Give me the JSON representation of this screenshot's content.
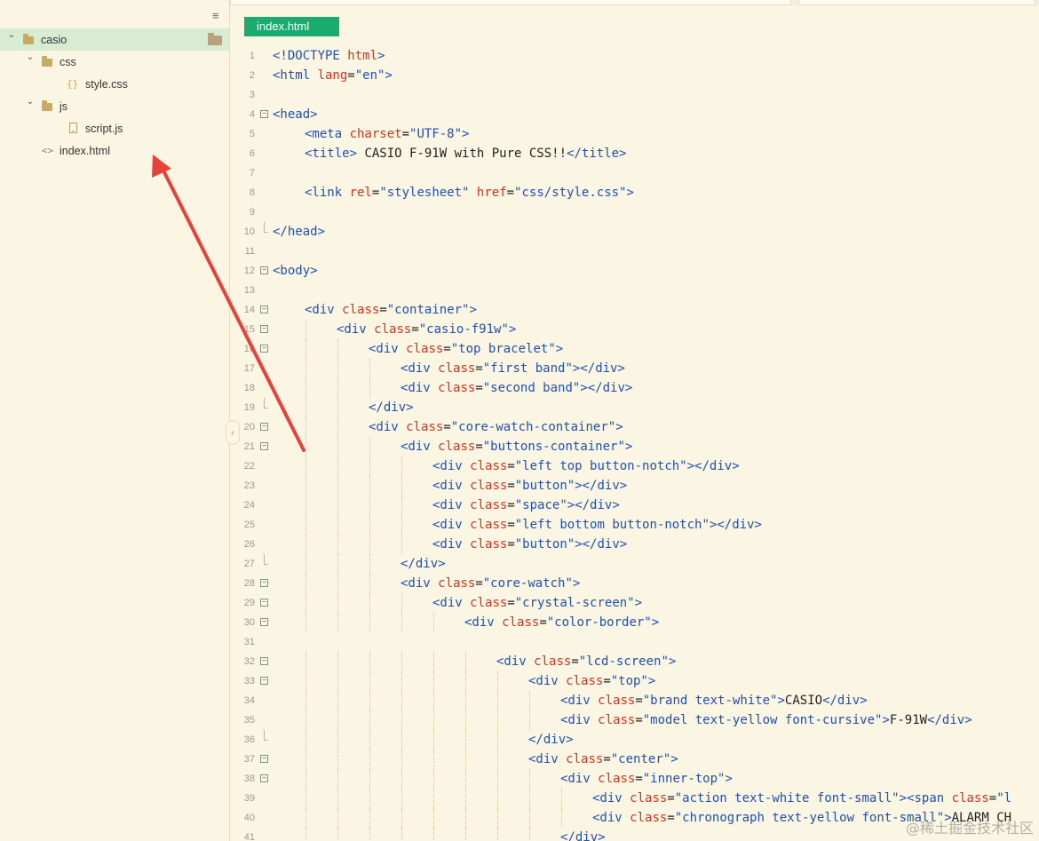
{
  "sidebar": {
    "tree": [
      {
        "label": "casio",
        "type": "folder",
        "depth": 0,
        "expanded": true,
        "selected": true
      },
      {
        "label": "css",
        "type": "folder",
        "depth": 1,
        "expanded": true
      },
      {
        "label": "style.css",
        "type": "css-file",
        "depth": 2
      },
      {
        "label": "js",
        "type": "folder",
        "depth": 1,
        "expanded": true
      },
      {
        "label": "script.js",
        "type": "js-file",
        "depth": 2
      },
      {
        "label": "index.html",
        "type": "html-file",
        "depth": 1
      }
    ],
    "menu_icon": "hamburger-icon",
    "collapse_glyph": "‹"
  },
  "editor": {
    "active_tab": "index.html",
    "lines": [
      {
        "n": "1",
        "indent": 0,
        "tokens": [
          [
            "tag",
            "<!DOCTYPE "
          ],
          [
            "attr",
            "html"
          ],
          [
            "tag",
            ">"
          ]
        ]
      },
      {
        "n": "2",
        "indent": 0,
        "tokens": [
          [
            "tag",
            "<html "
          ],
          [
            "attr",
            "lang"
          ],
          [
            "plain",
            "="
          ],
          [
            "val",
            "\"en\""
          ],
          [
            "tag",
            ">"
          ]
        ]
      },
      {
        "n": "3",
        "indent": 0,
        "tokens": []
      },
      {
        "n": "4",
        "indent": 0,
        "fold": true,
        "tokens": [
          [
            "tag",
            "<head>"
          ]
        ]
      },
      {
        "n": "5",
        "indent": 1,
        "tokens": [
          [
            "tag",
            "<meta "
          ],
          [
            "attr",
            "charset"
          ],
          [
            "plain",
            "="
          ],
          [
            "val",
            "\"UTF-8\""
          ],
          [
            "tag",
            ">"
          ]
        ]
      },
      {
        "n": "6",
        "indent": 1,
        "tokens": [
          [
            "tag",
            "<title>"
          ],
          [
            "plain",
            " CASIO F-91W with Pure CSS!!"
          ],
          [
            "tag",
            "</title>"
          ]
        ]
      },
      {
        "n": "7",
        "indent": 0,
        "tokens": []
      },
      {
        "n": "8",
        "indent": 1,
        "tokens": [
          [
            "tag",
            "<link "
          ],
          [
            "attr",
            "rel"
          ],
          [
            "plain",
            "="
          ],
          [
            "val",
            "\"stylesheet\" "
          ],
          [
            "attr",
            "href"
          ],
          [
            "plain",
            "="
          ],
          [
            "val",
            "\"css/style.css\""
          ],
          [
            "tag",
            ">"
          ]
        ]
      },
      {
        "n": "9",
        "indent": 0,
        "tokens": []
      },
      {
        "n": "10",
        "indent": 0,
        "foldEnd": true,
        "tokens": [
          [
            "tag",
            "</head>"
          ]
        ]
      },
      {
        "n": "11",
        "indent": 0,
        "tokens": []
      },
      {
        "n": "12",
        "indent": 0,
        "fold": true,
        "tokens": [
          [
            "tag",
            "<body>"
          ]
        ]
      },
      {
        "n": "13",
        "indent": 0,
        "tokens": []
      },
      {
        "n": "14",
        "indent": 1,
        "fold": true,
        "tokens": [
          [
            "tag",
            "<div "
          ],
          [
            "attr",
            "class"
          ],
          [
            "plain",
            "="
          ],
          [
            "val",
            "\"container\""
          ],
          [
            "tag",
            ">"
          ]
        ]
      },
      {
        "n": "15",
        "indent": 2,
        "fold": true,
        "tokens": [
          [
            "tag",
            "<div "
          ],
          [
            "attr",
            "class"
          ],
          [
            "plain",
            "="
          ],
          [
            "val",
            "\"casio-f91w\""
          ],
          [
            "tag",
            ">"
          ]
        ]
      },
      {
        "n": "16",
        "indent": 3,
        "fold": true,
        "tokens": [
          [
            "tag",
            "<div "
          ],
          [
            "attr",
            "class"
          ],
          [
            "plain",
            "="
          ],
          [
            "val",
            "\"top bracelet\""
          ],
          [
            "tag",
            ">"
          ]
        ]
      },
      {
        "n": "17",
        "indent": 4,
        "tokens": [
          [
            "tag",
            "<div "
          ],
          [
            "attr",
            "class"
          ],
          [
            "plain",
            "="
          ],
          [
            "val",
            "\"first band\""
          ],
          [
            "tag",
            "></div>"
          ]
        ]
      },
      {
        "n": "18",
        "indent": 4,
        "tokens": [
          [
            "tag",
            "<div "
          ],
          [
            "attr",
            "class"
          ],
          [
            "plain",
            "="
          ],
          [
            "val",
            "\"second band\""
          ],
          [
            "tag",
            "></div>"
          ]
        ]
      },
      {
        "n": "19",
        "indent": 3,
        "foldEnd": true,
        "tokens": [
          [
            "tag",
            "</div>"
          ]
        ]
      },
      {
        "n": "20",
        "indent": 3,
        "fold": true,
        "tokens": [
          [
            "tag",
            "<div "
          ],
          [
            "attr",
            "class"
          ],
          [
            "plain",
            "="
          ],
          [
            "val",
            "\"core-watch-container\""
          ],
          [
            "tag",
            ">"
          ]
        ]
      },
      {
        "n": "21",
        "indent": 4,
        "fold": true,
        "tokens": [
          [
            "tag",
            "<div "
          ],
          [
            "attr",
            "class"
          ],
          [
            "plain",
            "="
          ],
          [
            "val",
            "\"buttons-container\""
          ],
          [
            "tag",
            ">"
          ]
        ]
      },
      {
        "n": "22",
        "indent": 5,
        "tokens": [
          [
            "tag",
            "<div "
          ],
          [
            "attr",
            "class"
          ],
          [
            "plain",
            "="
          ],
          [
            "val",
            "\"left top button-notch\""
          ],
          [
            "tag",
            "></div>"
          ]
        ]
      },
      {
        "n": "23",
        "indent": 5,
        "tokens": [
          [
            "tag",
            "<div "
          ],
          [
            "attr",
            "class"
          ],
          [
            "plain",
            "="
          ],
          [
            "val",
            "\"button\""
          ],
          [
            "tag",
            "></div>"
          ]
        ]
      },
      {
        "n": "24",
        "indent": 5,
        "tokens": [
          [
            "tag",
            "<div "
          ],
          [
            "attr",
            "class"
          ],
          [
            "plain",
            "="
          ],
          [
            "val",
            "\"space\""
          ],
          [
            "tag",
            "></div>"
          ]
        ]
      },
      {
        "n": "25",
        "indent": 5,
        "tokens": [
          [
            "tag",
            "<div "
          ],
          [
            "attr",
            "class"
          ],
          [
            "plain",
            "="
          ],
          [
            "val",
            "\"left bottom button-notch\""
          ],
          [
            "tag",
            "></div>"
          ]
        ]
      },
      {
        "n": "26",
        "indent": 5,
        "tokens": [
          [
            "tag",
            "<div "
          ],
          [
            "attr",
            "class"
          ],
          [
            "plain",
            "="
          ],
          [
            "val",
            "\"button\""
          ],
          [
            "tag",
            "></div>"
          ]
        ]
      },
      {
        "n": "27",
        "indent": 4,
        "foldEnd": true,
        "tokens": [
          [
            "tag",
            "</div>"
          ]
        ]
      },
      {
        "n": "28",
        "indent": 4,
        "fold": true,
        "tokens": [
          [
            "tag",
            "<div "
          ],
          [
            "attr",
            "class"
          ],
          [
            "plain",
            "="
          ],
          [
            "val",
            "\"core-watch\""
          ],
          [
            "tag",
            ">"
          ]
        ]
      },
      {
        "n": "29",
        "indent": 5,
        "fold": true,
        "tokens": [
          [
            "tag",
            "<div "
          ],
          [
            "attr",
            "class"
          ],
          [
            "plain",
            "="
          ],
          [
            "val",
            "\"crystal-screen\""
          ],
          [
            "tag",
            ">"
          ]
        ]
      },
      {
        "n": "30",
        "indent": 6,
        "fold": true,
        "tokens": [
          [
            "tag",
            "<div "
          ],
          [
            "attr",
            "class"
          ],
          [
            "plain",
            "="
          ],
          [
            "val",
            "\"color-border\""
          ],
          [
            "tag",
            ">"
          ]
        ]
      },
      {
        "n": "31",
        "indent": 0,
        "tokens": []
      },
      {
        "n": "32",
        "indent": 7,
        "fold": true,
        "tokens": [
          [
            "tag",
            "<div "
          ],
          [
            "attr",
            "class"
          ],
          [
            "plain",
            "="
          ],
          [
            "val",
            "\"lcd-screen\""
          ],
          [
            "tag",
            ">"
          ]
        ]
      },
      {
        "n": "33",
        "indent": 8,
        "fold": true,
        "tokens": [
          [
            "tag",
            "<div "
          ],
          [
            "attr",
            "class"
          ],
          [
            "plain",
            "="
          ],
          [
            "val",
            "\"top\""
          ],
          [
            "tag",
            ">"
          ]
        ]
      },
      {
        "n": "34",
        "indent": 9,
        "tokens": [
          [
            "tag",
            "<div "
          ],
          [
            "attr",
            "class"
          ],
          [
            "plain",
            "="
          ],
          [
            "val",
            "\"brand text-white\""
          ],
          [
            "tag",
            ">"
          ],
          [
            "plain",
            "CASIO"
          ],
          [
            "tag",
            "</div>"
          ]
        ]
      },
      {
        "n": "35",
        "indent": 9,
        "tokens": [
          [
            "tag",
            "<div "
          ],
          [
            "attr",
            "class"
          ],
          [
            "plain",
            "="
          ],
          [
            "val",
            "\"model text-yellow font-cursive\""
          ],
          [
            "tag",
            ">"
          ],
          [
            "plain",
            "F-91W"
          ],
          [
            "tag",
            "</div>"
          ]
        ]
      },
      {
        "n": "36",
        "indent": 8,
        "foldEnd": true,
        "tokens": [
          [
            "tag",
            "</div>"
          ]
        ]
      },
      {
        "n": "37",
        "indent": 8,
        "fold": true,
        "tokens": [
          [
            "tag",
            "<div "
          ],
          [
            "attr",
            "class"
          ],
          [
            "plain",
            "="
          ],
          [
            "val",
            "\"center\""
          ],
          [
            "tag",
            ">"
          ]
        ]
      },
      {
        "n": "38",
        "indent": 9,
        "fold": true,
        "tokens": [
          [
            "tag",
            "<div "
          ],
          [
            "attr",
            "class"
          ],
          [
            "plain",
            "="
          ],
          [
            "val",
            "\"inner-top\""
          ],
          [
            "tag",
            ">"
          ]
        ]
      },
      {
        "n": "39",
        "indent": 10,
        "tokens": [
          [
            "tag",
            "<div "
          ],
          [
            "attr",
            "class"
          ],
          [
            "plain",
            "="
          ],
          [
            "val",
            "\"action text-white font-small\""
          ],
          [
            "tag",
            ">"
          ],
          [
            "tag",
            "<span "
          ],
          [
            "attr",
            "class"
          ],
          [
            "plain",
            "="
          ],
          [
            "val",
            "\"l"
          ]
        ]
      },
      {
        "n": "40",
        "indent": 10,
        "tokens": [
          [
            "tag",
            "<div "
          ],
          [
            "attr",
            "class"
          ],
          [
            "plain",
            "="
          ],
          [
            "val",
            "\"chronograph text-yellow font-small\""
          ],
          [
            "tag",
            ">"
          ],
          [
            "plain",
            "ALARM CH"
          ]
        ]
      },
      {
        "n": "41",
        "indent": 9,
        "tokens": [
          [
            "tag",
            "</div>"
          ]
        ]
      }
    ]
  },
  "annotation": {
    "arrow_color": "#e8413a"
  },
  "watermark": "@稀土掘金技术社区"
}
